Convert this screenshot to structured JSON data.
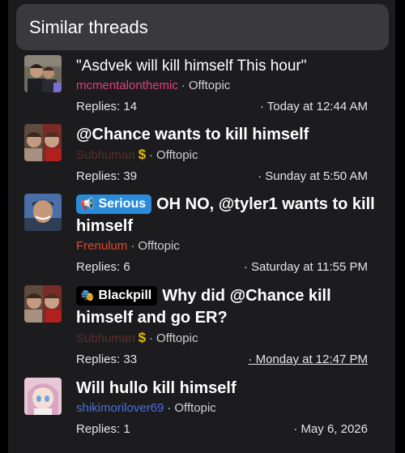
{
  "header": {
    "title": "Similar threads"
  },
  "colors": {
    "username_pink": "#e0407a",
    "username_red": "#e04a2a",
    "username_dark": "#5a2f2a",
    "username_blue": "#4a6ee0",
    "serious_prefix": "#2a8bd8"
  },
  "threads": [
    {
      "title": "\"Asdvek will kill himself This hour\"",
      "username": "mcmentalonthemic",
      "forum": "Offtopic",
      "replies": "Replies: 14",
      "date": "Today at 12:44 AM"
    },
    {
      "title": "@Chance wants to kill himself",
      "username": "Subhuman",
      "forum": "Offtopic",
      "replies": "Replies: 39",
      "date": "Sunday at 5:50 AM"
    },
    {
      "prefix": "Serious",
      "title": "OH NO, @tyler1 wants to kill himself",
      "username": "Frenulum",
      "forum": "Offtopic",
      "replies": "Replies: 6",
      "date": "Saturday at 11:55 PM"
    },
    {
      "prefix": "Blackpill",
      "title": "Why did @Chance kill himself and go ER?",
      "username": "Subhuman",
      "forum": "Offtopic",
      "replies": "Replies: 33",
      "date": "Monday at 12:47 PM"
    },
    {
      "title": "Will hullo kill himself",
      "username": "shikimorilover69",
      "forum": "Offtopic",
      "replies": "Replies: 1",
      "date": "May 6, 2026"
    }
  ]
}
